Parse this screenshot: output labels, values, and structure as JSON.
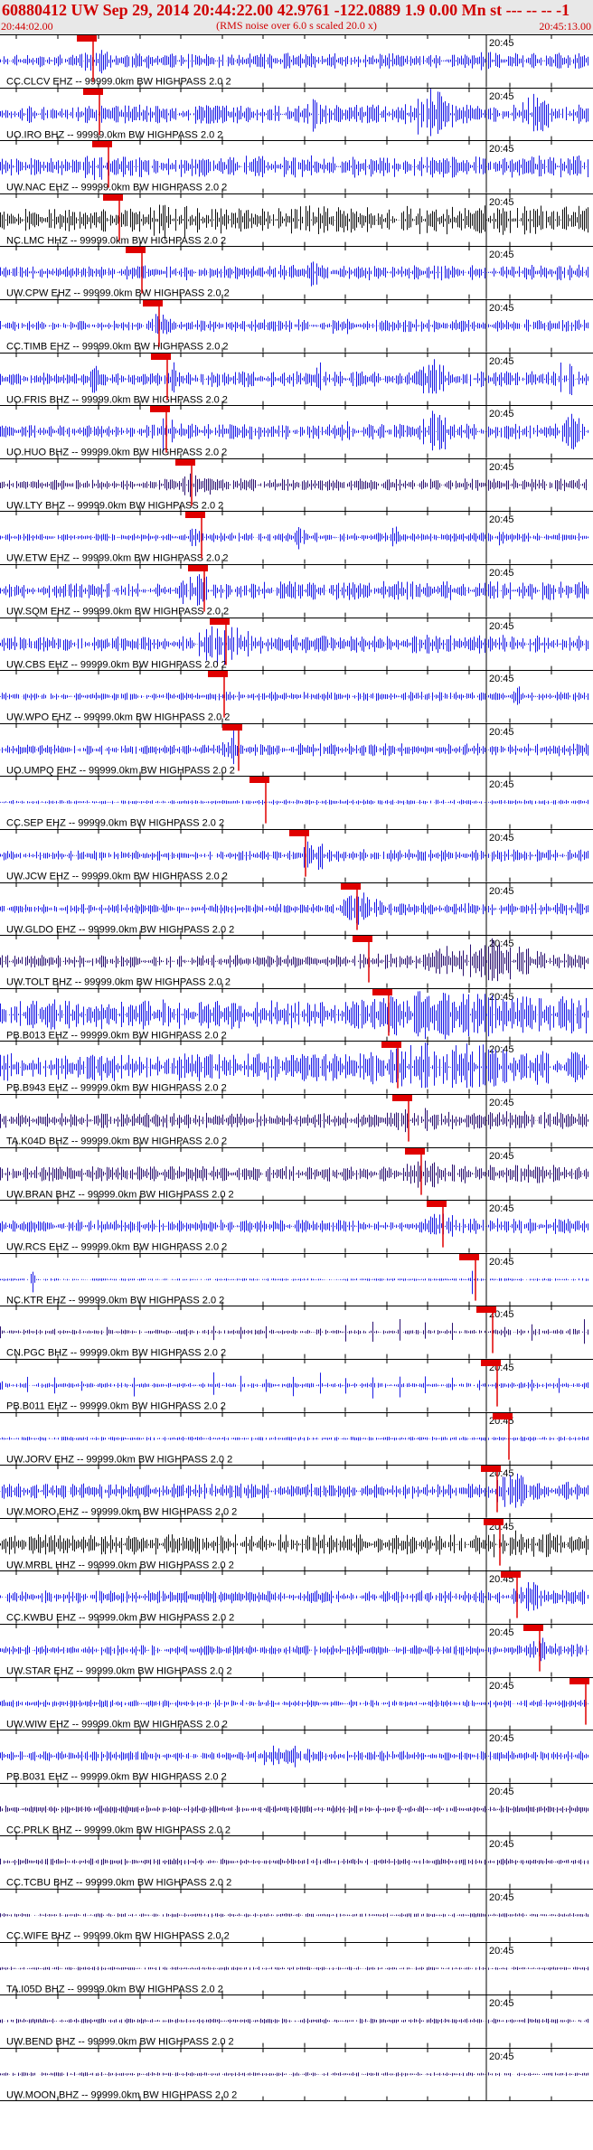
{
  "header": {
    "title": "60880412 UW Sep 29, 2014 20:44:22.00   42.9761 -122.0889  1.9 0.00 Mn st --- -- --  -1",
    "subtitle": "(RMS noise over 6.0 s scaled 20.0 x)",
    "start_time": "20:44:02.00",
    "end_time": "20:45:13.00"
  },
  "chart_data": {
    "type": "line",
    "title": "60880412 UW Sep 29, 2014 20:44:22.00   42.9761 -122.0889  1.9 0.00 Mn st --- -- --  -1",
    "subtitle": "(RMS noise over 6.0 s scaled 20.0 x)",
    "xlim": [
      "20:44:02.00",
      "20:45:13.00"
    ],
    "minute_mark_label": "20:45",
    "grid": true,
    "colors": {
      "trace_blue": "#1a1ae6",
      "trace_dark": "#2a1070",
      "trace_black": "#111111",
      "pick_red": "#e00000",
      "grid": "#000000"
    },
    "channels": [
      {
        "station": "CC.CLCV EHZ -- 99999.0km BW  HIGHPASS  2.0  2",
        "color": "#1a1ae6",
        "pick": 0.128,
        "amp": 0.25,
        "events": [
          [
            0.17,
            0.55,
            0.05
          ],
          [
            0.82,
            0.45,
            0.04
          ]
        ]
      },
      {
        "station": "UO.IRO BHZ -- 99999.0km BW  HIGHPASS  2.0  2",
        "color": "#1a1ae6",
        "pick": 0.139,
        "amp": 0.3,
        "events": [
          [
            0.05,
            0.5,
            0.01
          ],
          [
            0.53,
            0.9,
            0.015
          ],
          [
            0.73,
            1.0,
            0.05
          ],
          [
            0.91,
            0.9,
            0.03
          ]
        ]
      },
      {
        "station": "UW.NAC EHZ -- 99999.0km BW  HIGHPASS  2.0  2",
        "color": "#1a1ae6",
        "pick": 0.155,
        "amp": 0.35,
        "events": [
          [
            0.16,
            0.6,
            0.05
          ],
          [
            0.5,
            0.4,
            0.15
          ]
        ]
      },
      {
        "station": "NC.LMC HHZ -- 99999.0km BW  HIGHPASS  2.0  2",
        "color": "#111111",
        "pick": 0.174,
        "amp": 0.45,
        "events": [
          [
            0.29,
            0.8,
            0.07
          ],
          [
            0.84,
            0.6,
            0.1
          ]
        ]
      },
      {
        "station": "UW.CPW EHZ -- 99999.0km BW  HIGHPASS  2.0  2",
        "color": "#1a1ae6",
        "pick": 0.214,
        "amp": 0.25,
        "events": [
          [
            0.53,
            0.6,
            0.015
          ]
        ]
      },
      {
        "station": "CC.TIMB EHZ -- 99999.0km BW  HIGHPASS  2.0  2",
        "color": "#1a1ae6",
        "pick": 0.244,
        "amp": 0.2,
        "events": [
          [
            0.27,
            0.5,
            0.03
          ],
          [
            0.58,
            0.35,
            0.05
          ]
        ]
      },
      {
        "station": "UO.FRIS BHZ -- 99999.0km BW  HIGHPASS  2.0  2",
        "color": "#1a1ae6",
        "pick": 0.258,
        "amp": 0.25,
        "events": [
          [
            0.16,
            0.7,
            0.01
          ],
          [
            0.3,
            0.8,
            0.015
          ],
          [
            0.54,
            0.8,
            0.01
          ],
          [
            0.73,
            0.9,
            0.03
          ],
          [
            0.96,
            0.8,
            0.02
          ]
        ]
      },
      {
        "station": "UO.HUO BHZ -- 99999.0km BW  HIGHPASS  2.0  2",
        "color": "#1a1ae6",
        "pick": 0.256,
        "amp": 0.25,
        "events": [
          [
            0.28,
            0.9,
            0.015
          ],
          [
            0.58,
            0.7,
            0.015
          ],
          [
            0.74,
            0.9,
            0.03
          ],
          [
            0.97,
            0.8,
            0.02
          ]
        ]
      },
      {
        "station": "UW.LTY BHZ -- 99999.0km BW  HIGHPASS  2.0  2",
        "color": "#2a1070",
        "pick": 0.3,
        "amp": 0.2,
        "events": [
          [
            0.33,
            0.5,
            0.06
          ]
        ]
      },
      {
        "station": "UW.ETW EHZ -- 99999.0km BW  HIGHPASS  2.0  2",
        "color": "#1a1ae6",
        "pick": 0.318,
        "amp": 0.15,
        "events": [
          [
            0.33,
            0.6,
            0.01
          ],
          [
            0.51,
            0.6,
            0.01
          ],
          [
            0.67,
            0.5,
            0.01
          ],
          [
            0.85,
            0.5,
            0.01
          ]
        ]
      },
      {
        "station": "UW.SQM EHZ -- 99999.0km BW  HIGHPASS  2.0  2",
        "color": "#1a1ae6",
        "pick": 0.322,
        "amp": 0.3,
        "events": [
          [
            0.33,
            0.7,
            0.05
          ]
        ]
      },
      {
        "station": "UW.CBS EHZ -- 99999.0km BW  HIGHPASS  2.0  2",
        "color": "#1a1ae6",
        "pick": 0.36,
        "amp": 0.3,
        "events": [
          [
            0.38,
            0.95,
            0.06
          ]
        ]
      },
      {
        "station": "UW.WPO EHZ -- 99999.0km BW  HIGHPASS  2.0  2",
        "color": "#1a1ae6",
        "pick": 0.358,
        "amp": 0.15,
        "events": [
          [
            0.88,
            0.4,
            0.02
          ]
        ]
      },
      {
        "station": "UO.UMPQ EHZ -- 99999.0km BW  HIGHPASS  2.0  2",
        "color": "#1a1ae6",
        "pick": 0.383,
        "amp": 0.2,
        "events": [
          [
            0.39,
            0.9,
            0.015
          ]
        ]
      },
      {
        "station": "CC.SEP EHZ -- 99999.0km BW  HIGHPASS  2.0  2",
        "color": "#1a1ae6",
        "pick": 0.43,
        "amp": 0.08,
        "events": []
      },
      {
        "station": "UW.JCW EHZ -- 99999.0km BW  HIGHPASS  2.0  2",
        "color": "#1a1ae6",
        "pick": 0.5,
        "amp": 0.2,
        "events": [
          [
            0.53,
            0.8,
            0.03
          ]
        ]
      },
      {
        "station": "UW.GLDO EHZ -- 99999.0km BW  HIGHPASS  2.0  2",
        "color": "#1a1ae6",
        "pick": 0.59,
        "amp": 0.2,
        "events": [
          [
            0.61,
            0.7,
            0.04
          ]
        ]
      },
      {
        "station": "UW.TOLT BHZ -- 99999.0km BW  HIGHPASS  2.0  2",
        "color": "#2a1070",
        "pick": 0.61,
        "amp": 0.25,
        "events": [
          [
            0.82,
            0.95,
            0.1
          ]
        ]
      },
      {
        "station": "PB.B013 EHZ -- 99999.0km BW  HIGHPASS  2.0  2",
        "color": "#1a1ae6",
        "pick": 0.645,
        "amp": 0.6,
        "events": [
          [
            0.75,
            1.0,
            0.2
          ]
        ]
      },
      {
        "station": "PB.B943 EHZ -- 99999.0km BW  HIGHPASS  2.0  2",
        "color": "#1a1ae6",
        "pick": 0.662,
        "amp": 0.55,
        "events": [
          [
            0.75,
            1.0,
            0.2
          ]
        ]
      },
      {
        "station": "TA.K04D BHZ -- 99999.0km BW  HIGHPASS  2.0  2",
        "color": "#2a1070",
        "pick": 0.68,
        "amp": 0.3,
        "events": [
          [
            0.7,
            0.6,
            0.06
          ]
        ]
      },
      {
        "station": "UW.BRAN BHZ -- 99999.0km BW  HIGHPASS  2.0  2",
        "color": "#2a1070",
        "pick": 0.702,
        "amp": 0.3,
        "events": [
          [
            0.72,
            0.6,
            0.05
          ]
        ]
      },
      {
        "station": "UW.RCS EHZ -- 99999.0km BW  HIGHPASS  2.0  2",
        "color": "#1a1ae6",
        "pick": 0.74,
        "amp": 0.25,
        "events": [
          [
            0.75,
            0.6,
            0.04
          ]
        ]
      },
      {
        "station": "NC.KTR EHZ -- 99999.0km BW  HIGHPASS  2.0  2",
        "color": "#1a1ae6",
        "pick": 0.797,
        "amp": 0.05,
        "events": [
          [
            0.055,
            0.5,
            0.004
          ],
          [
            0.8,
            0.6,
            0.004
          ]
        ]
      },
      {
        "station": "CN.PGC BHZ -- 99999.0km BW  HIGHPASS  2.0  2",
        "color": "#2a1070",
        "pick": 0.827,
        "amp": 0.1,
        "periodic": 0.045,
        "events": []
      },
      {
        "station": "PB.B011 EHZ -- 99999.0km BW  HIGHPASS  2.0  2",
        "color": "#1a1ae6",
        "pick": 0.836,
        "amp": 0.1,
        "periodic": 0.045,
        "events": []
      },
      {
        "station": "UW.JORV EHZ -- 99999.0km BW  HIGHPASS  2.0  2",
        "color": "#1a1ae6",
        "pick": 0.856,
        "amp": 0.08,
        "events": []
      },
      {
        "station": "UW.MORO EHZ -- 99999.0km BW  HIGHPASS  2.0  2",
        "color": "#1a1ae6",
        "pick": 0.836,
        "amp": 0.3,
        "events": [
          [
            0.87,
            0.8,
            0.04
          ]
        ]
      },
      {
        "station": "UW.MRBL HHZ -- 99999.0km BW  HIGHPASS  2.0  2",
        "color": "#111111",
        "pick": 0.84,
        "amp": 0.4,
        "events": [
          [
            0.86,
            0.7,
            0.04
          ]
        ]
      },
      {
        "station": "CC.KWBU EHZ -- 99999.0km BW  HIGHPASS  2.0  2",
        "color": "#1a1ae6",
        "pick": 0.87,
        "amp": 0.25,
        "events": [
          [
            0.9,
            0.6,
            0.04
          ]
        ]
      },
      {
        "station": "UW.STAR EHZ -- 99999.0km BW  HIGHPASS  2.0  2",
        "color": "#1a1ae6",
        "pick": 0.91,
        "amp": 0.2,
        "events": [
          [
            0.92,
            0.5,
            0.03
          ]
        ]
      },
      {
        "station": "UW.WIW EHZ -- 99999.0km BW  HIGHPASS  2.0  2",
        "color": "#1a1ae6",
        "pick": 0.99,
        "amp": 0.15,
        "events": []
      },
      {
        "station": "PB.B031 EHZ -- 99999.0km BW  HIGHPASS  2.0  2",
        "color": "#1a1ae6",
        "pick": null,
        "amp": 0.2,
        "events": [
          [
            0.48,
            0.5,
            0.06
          ]
        ]
      },
      {
        "station": "CC.PRLK BHZ -- 99999.0km BW  HIGHPASS  2.0  2",
        "color": "#2a1070",
        "pick": null,
        "amp": 0.15,
        "events": []
      },
      {
        "station": "CC.TCBU BHZ -- 99999.0km BW  HIGHPASS  2.0  2",
        "color": "#2a1070",
        "pick": null,
        "amp": 0.13,
        "events": []
      },
      {
        "station": "CC.WIFE BHZ -- 99999.0km BW  HIGHPASS  2.0  2",
        "color": "#2a1070",
        "pick": null,
        "amp": 0.08,
        "events": []
      },
      {
        "station": "TA.I05D BHZ -- 99999.0km BW  HIGHPASS  2.0  2",
        "color": "#2a1070",
        "pick": null,
        "amp": 0.07,
        "events": []
      },
      {
        "station": "UW.BEND BHZ -- 99999.0km BW  HIGHPASS  2.0  2",
        "color": "#2a1070",
        "pick": null,
        "amp": 0.1,
        "events": []
      },
      {
        "station": "UW.MOON BHZ -- 99999.0km BW  HIGHPASS  2.0  2",
        "color": "#2a1070",
        "pick": null,
        "amp": 0.08,
        "events": []
      }
    ]
  }
}
